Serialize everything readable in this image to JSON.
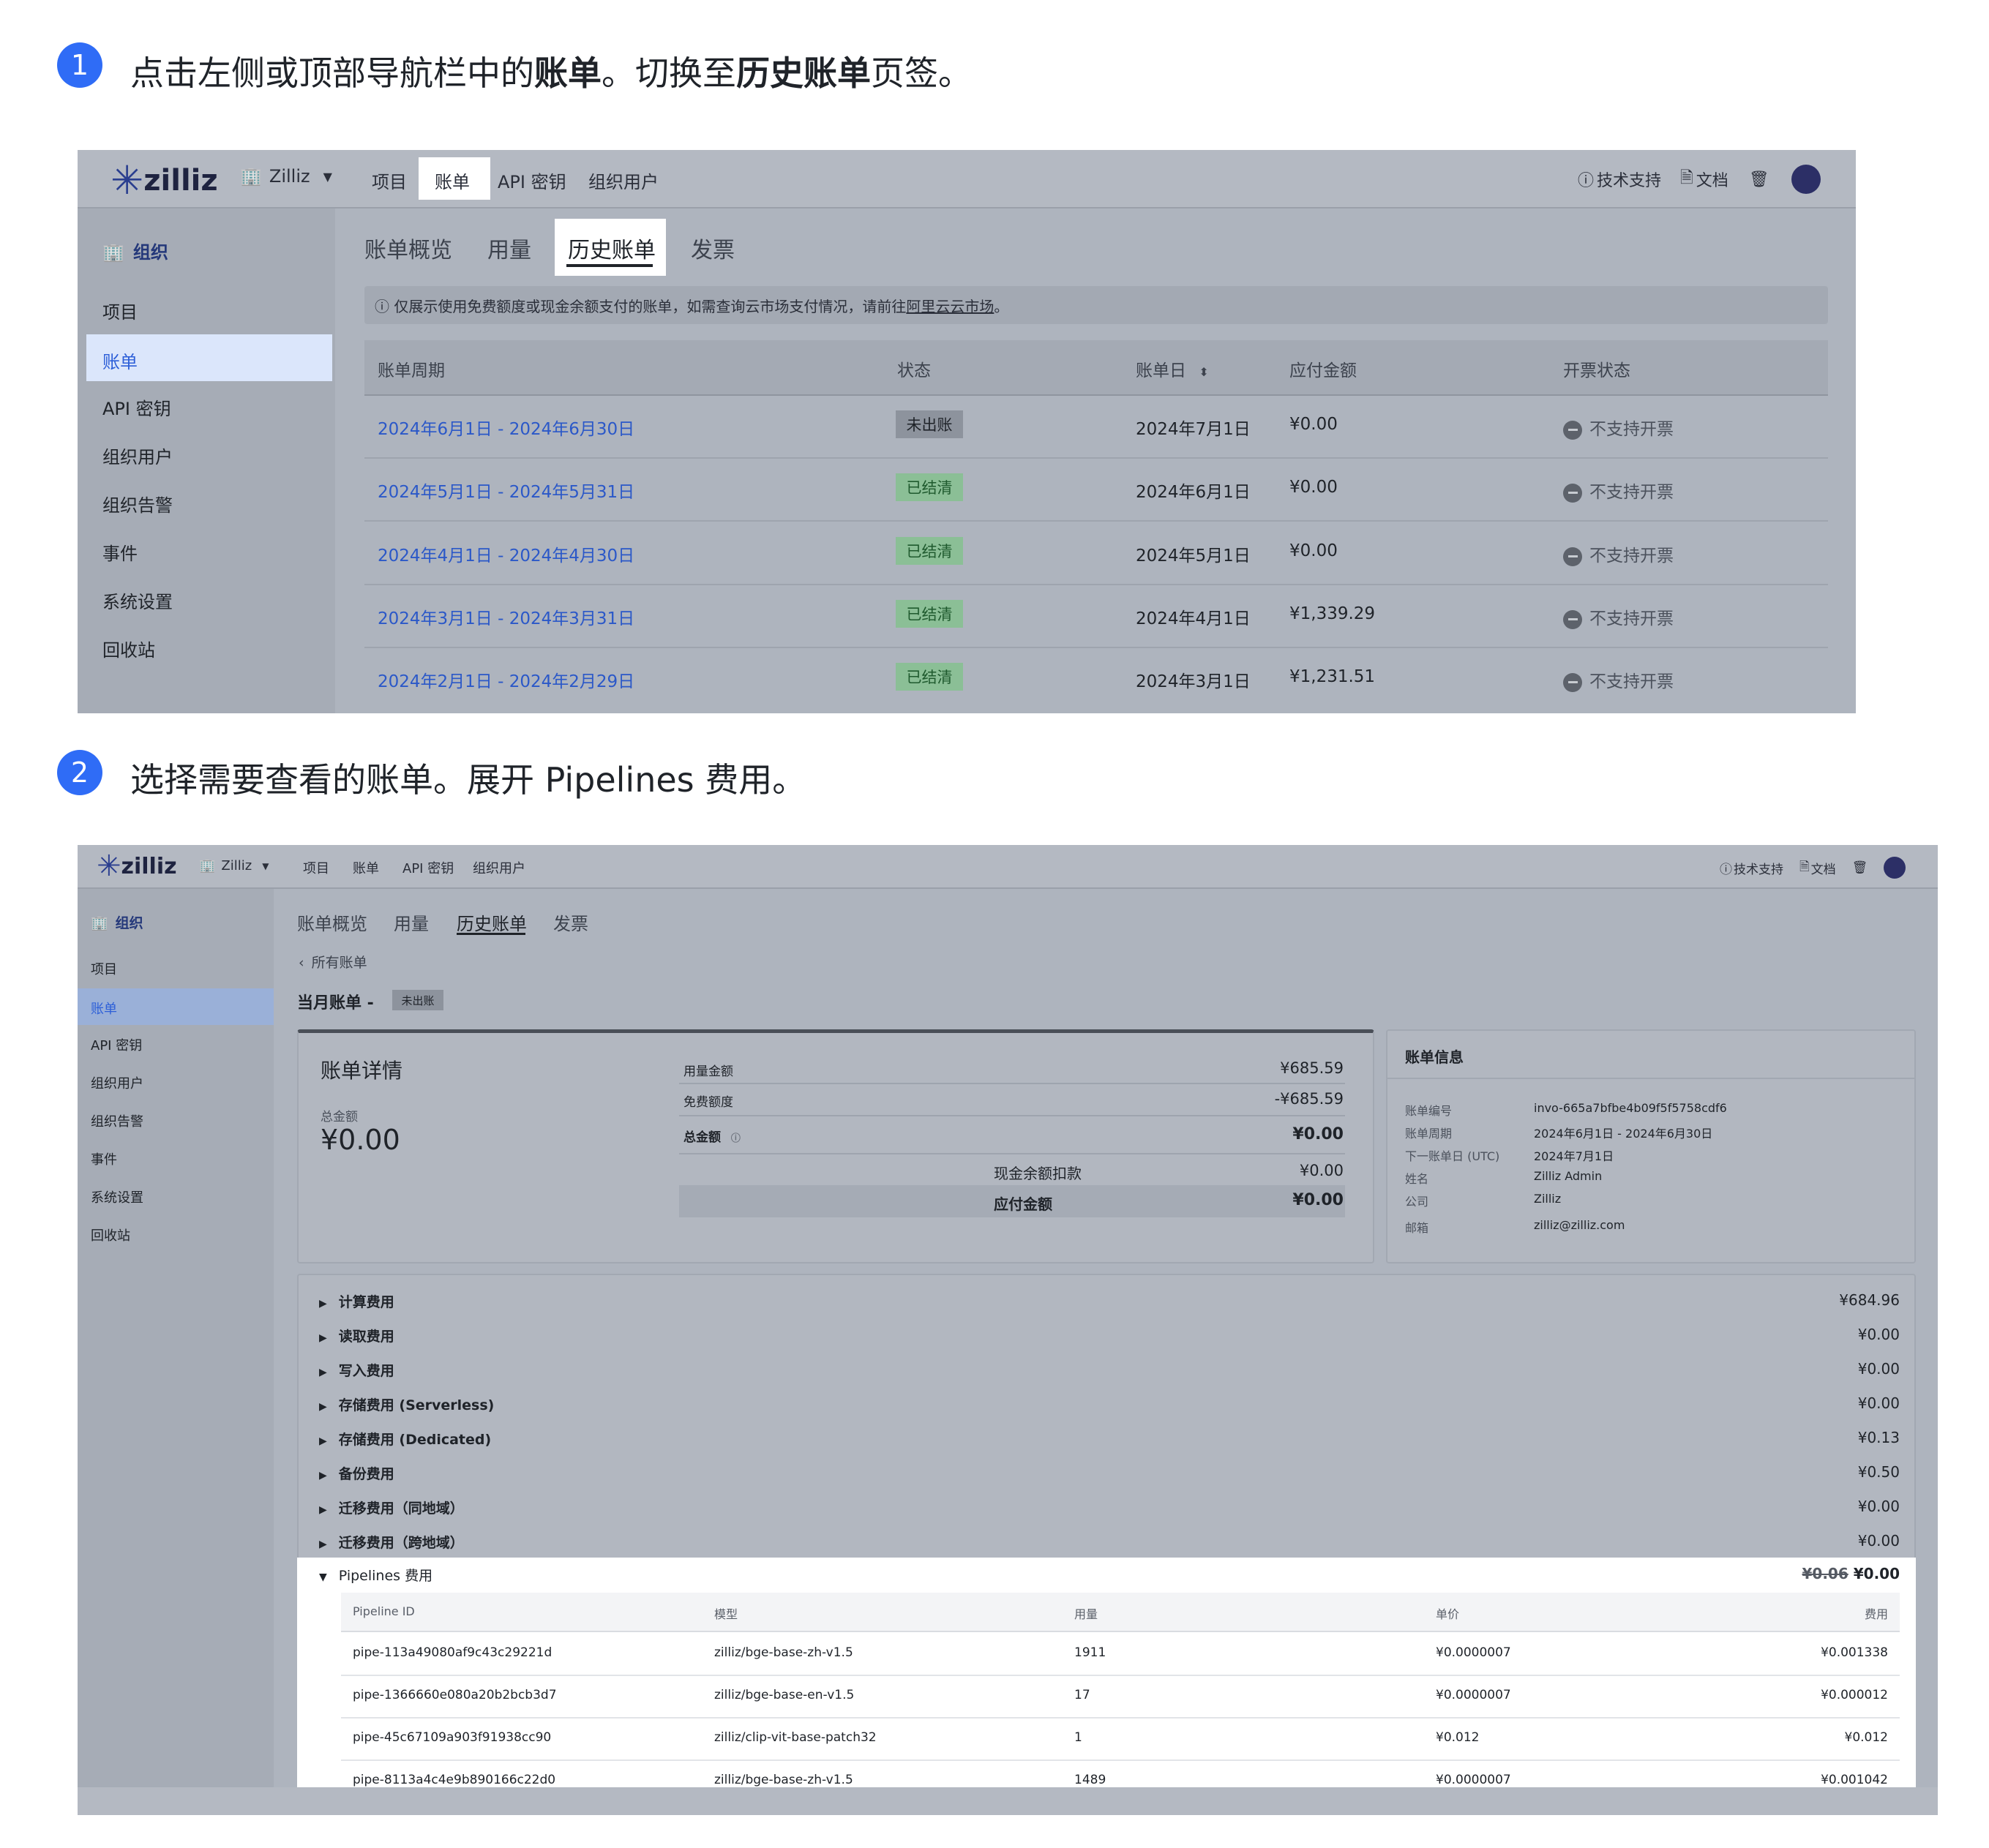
{
  "step1": {
    "number": "1",
    "text_parts": [
      "点击左侧或顶部导航栏中的",
      "账单",
      "。切换至",
      "历史账单",
      "页签。"
    ]
  },
  "step2": {
    "number": "2",
    "text": "选择需要查看的账单。展开 Pipelines 费用。"
  },
  "app": {
    "brand": "zilliz",
    "org_selector": "Zilliz",
    "nav": [
      "项目",
      "账单",
      "API 密钥",
      "组织用户"
    ],
    "active_nav": "账单",
    "tools": {
      "support": "技术支持",
      "docs": "文档"
    },
    "sidebar_head": "组织",
    "sidebar": [
      "项目",
      "账单",
      "API 密钥",
      "组织用户",
      "组织告警",
      "事件",
      "系统设置",
      "回收站"
    ],
    "active_sidebar": "账单",
    "tabs": [
      "账单概览",
      "用量",
      "历史账单",
      "发票"
    ],
    "active_tab": "历史账单"
  },
  "history": {
    "notice_prefix": "仅展示使用免费额度或现金余额支付的账单，如需查询云市场支付情况，请前往",
    "notice_link": "阿里云云市场",
    "notice_suffix": "。",
    "columns": [
      "账单周期",
      "状态",
      "账单日",
      "应付金额",
      "开票状态"
    ],
    "rows": [
      {
        "period": "2024年6月1日 - 2024年6月30日",
        "status": "未出账",
        "status_type": "grey",
        "bill_date": "2024年7月1日",
        "amount": "¥0.00",
        "invoice": "不支持开票"
      },
      {
        "period": "2024年5月1日 - 2024年5月31日",
        "status": "已结清",
        "status_type": "green",
        "bill_date": "2024年6月1日",
        "amount": "¥0.00",
        "invoice": "不支持开票"
      },
      {
        "period": "2024年4月1日 - 2024年4月30日",
        "status": "已结清",
        "status_type": "green",
        "bill_date": "2024年5月1日",
        "amount": "¥0.00",
        "invoice": "不支持开票"
      },
      {
        "period": "2024年3月1日 - 2024年3月31日",
        "status": "已结清",
        "status_type": "green",
        "bill_date": "2024年4月1日",
        "amount": "¥1,339.29",
        "invoice": "不支持开票"
      },
      {
        "period": "2024年2月1日 - 2024年2月29日",
        "status": "已结清",
        "status_type": "green",
        "bill_date": "2024年3月1日",
        "amount": "¥1,231.51",
        "invoice": "不支持开票"
      }
    ]
  },
  "detail": {
    "back": "所有账单",
    "title": "当月账单 -",
    "title_badge": "未出账",
    "card_title": "账单详情",
    "total_label": "总金额",
    "total_value": "¥0.00",
    "lines": [
      {
        "label": "用量金额",
        "value": "¥685.59"
      },
      {
        "label": "免费额度",
        "value": "-¥685.59"
      },
      {
        "label": "总金额",
        "value": "¥0.00"
      }
    ],
    "cash_label": "现金余额扣款",
    "cash_value": "¥0.00",
    "payable_label": "应付金额",
    "payable_value": "¥0.00",
    "info_title": "账单信息",
    "info": [
      {
        "label": "账单编号",
        "value": "invo-665a7bfbe4b09f5f5758cdf6"
      },
      {
        "label": "账单周期",
        "value": "2024年6月1日 - 2024年6月30日"
      },
      {
        "label": "下一账单日 (UTC)",
        "value": "2024年7月1日"
      },
      {
        "label": "姓名",
        "value": "Zilliz Admin"
      },
      {
        "label": "公司",
        "value": "Zilliz"
      },
      {
        "label": "邮箱",
        "value": "zilliz@zilliz.com"
      }
    ],
    "fees": [
      {
        "label": "计算费用",
        "value": "¥684.96"
      },
      {
        "label": "读取费用",
        "value": "¥0.00"
      },
      {
        "label": "写入费用",
        "value": "¥0.00"
      },
      {
        "label": "存储费用 (Serverless)",
        "value": "¥0.00"
      },
      {
        "label": "存储费用 (Dedicated)",
        "value": "¥0.13"
      },
      {
        "label": "备份费用",
        "value": "¥0.50"
      },
      {
        "label": "迁移费用（同地域）",
        "value": "¥0.00"
      },
      {
        "label": "迁移费用（跨地域）",
        "value": "¥0.00"
      }
    ],
    "pipelines": {
      "label": "Pipelines 费用",
      "old_value": "¥0.06",
      "value": "¥0.00",
      "columns": [
        "Pipeline ID",
        "模型",
        "用量",
        "单价",
        "费用"
      ],
      "rows": [
        {
          "id": "pipe-113a49080af9c43c29221d",
          "model": "zilliz/bge-base-zh-v1.5",
          "usage": "1911",
          "price": "¥0.0000007",
          "fee": "¥0.001338"
        },
        {
          "id": "pipe-1366660e080a20b2bcb3d7",
          "model": "zilliz/bge-base-en-v1.5",
          "usage": "17",
          "price": "¥0.0000007",
          "fee": "¥0.000012"
        },
        {
          "id": "pipe-45c67109a903f91938cc90",
          "model": "zilliz/clip-vit-base-patch32",
          "usage": "1",
          "price": "¥0.012",
          "fee": "¥0.012"
        },
        {
          "id": "pipe-8113a4c4e9b890166c22d0",
          "model": "zilliz/bge-base-zh-v1.5",
          "usage": "1489",
          "price": "¥0.0000007",
          "fee": "¥0.001042"
        }
      ]
    }
  }
}
